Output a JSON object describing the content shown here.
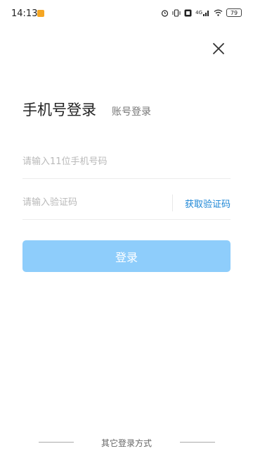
{
  "status_bar": {
    "time": "14:13",
    "network": "4G",
    "battery": "79"
  },
  "title": {
    "main": "手机号登录",
    "alt": "账号登录"
  },
  "phone": {
    "placeholder": "请输入11位手机号码"
  },
  "code": {
    "placeholder": "请输入验证码",
    "get_code_label": "获取验证码"
  },
  "login_button": "登录",
  "footer": {
    "other_login": "其它登录方式"
  },
  "colors": {
    "accent": "#1c86d6",
    "button_bg": "#8ecdfb",
    "notification": "#f5a623"
  }
}
